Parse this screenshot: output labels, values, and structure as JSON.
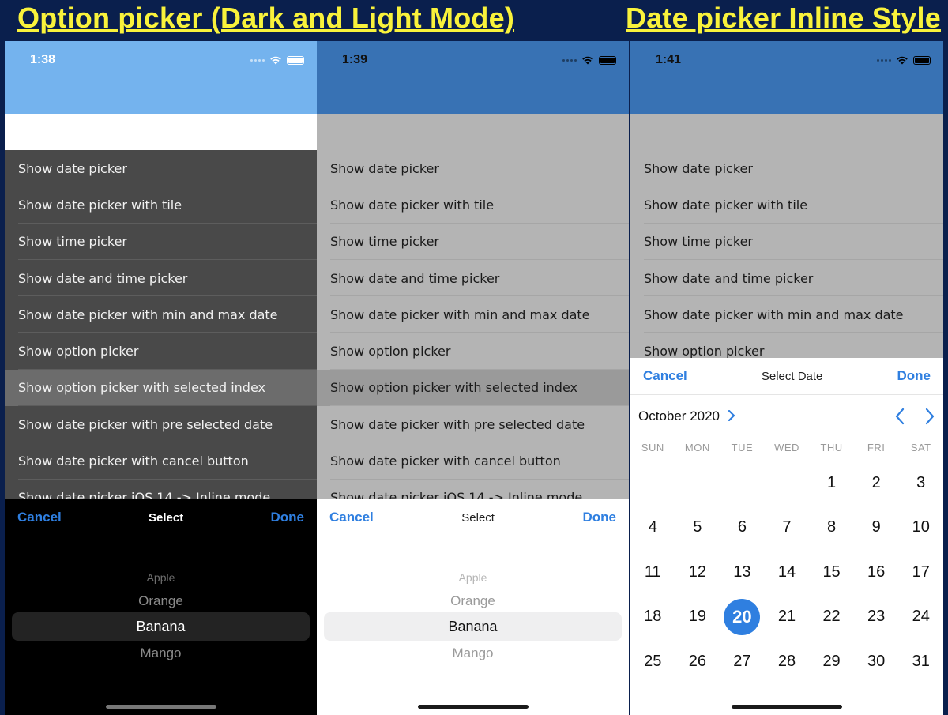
{
  "captions": {
    "left": "Option picker (Dark and Light Mode)",
    "right": "Date picker Inline Style"
  },
  "accent_color": "#2f7fe0",
  "phones": [
    {
      "time": "1:38",
      "mode": "dark",
      "selected_row_index": 6,
      "toolbar": {
        "cancel": "Cancel",
        "title": "Select",
        "done": "Done"
      },
      "options": [
        "Apple",
        "Orange",
        "Banana",
        "Mango"
      ],
      "selected_option": "Banana"
    },
    {
      "time": "1:39",
      "mode": "light",
      "selected_row_index": 6,
      "toolbar": {
        "cancel": "Cancel",
        "title": "Select",
        "done": "Done"
      },
      "options": [
        "Apple",
        "Orange",
        "Banana",
        "Mango"
      ],
      "selected_option": "Banana"
    },
    {
      "time": "1:41",
      "mode": "light",
      "toolbar": {
        "cancel": "Cancel",
        "title": "Select Date",
        "done": "Done"
      },
      "calendar": {
        "month_label": "October 2020",
        "weekdays": [
          "SUN",
          "MON",
          "TUE",
          "WED",
          "THU",
          "FRI",
          "SAT"
        ],
        "days": [
          "",
          "",
          "",
          "",
          "1",
          "2",
          "3",
          "4",
          "5",
          "6",
          "7",
          "8",
          "9",
          "10",
          "11",
          "12",
          "13",
          "14",
          "15",
          "16",
          "17",
          "18",
          "19",
          "20",
          "21",
          "22",
          "23",
          "24",
          "25",
          "26",
          "27",
          "28",
          "29",
          "30",
          "31"
        ],
        "selected_day": "20"
      }
    }
  ],
  "menu_items": [
    "Show date picker",
    "Show date picker with tile",
    "Show time picker",
    "Show date and time picker",
    "Show date picker with min and max date",
    "Show option picker",
    "Show option picker with selected index",
    "Show date picker with pre selected date",
    "Show date picker with cancel button",
    "Show date picker iOS 14 -> Inline mode"
  ]
}
